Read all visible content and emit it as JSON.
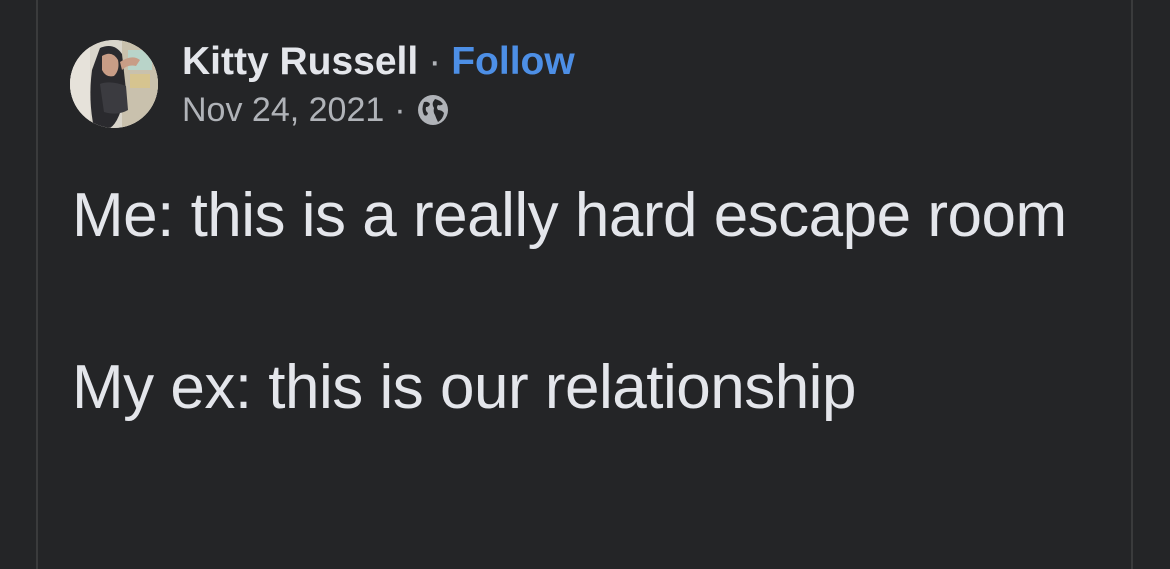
{
  "post": {
    "author": "Kitty Russell",
    "header_separator": "·",
    "follow_label": "Follow",
    "date": "Nov 24, 2021",
    "meta_separator": "·",
    "audience_icon": "globe-icon",
    "lines": [
      "Me: this is a really hard escape room",
      "My ex: this is our relationship"
    ]
  },
  "colors": {
    "background": "#242527",
    "text": "#e4e6eb",
    "muted": "#b0b3b8",
    "link": "#4d8fe6"
  }
}
